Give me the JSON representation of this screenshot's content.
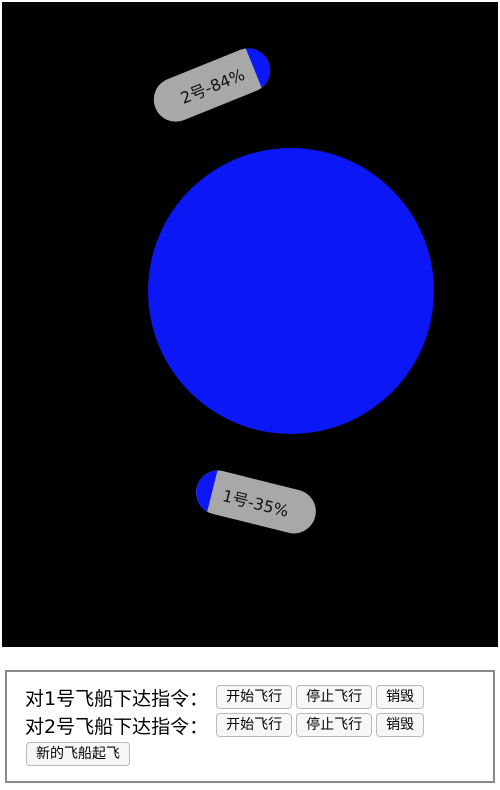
{
  "universe": {
    "background": "#000000",
    "planet_color": "#0b17f5"
  },
  "ships": [
    {
      "id": 1,
      "label": "1号-35%",
      "fuel_percent": 35,
      "color": "#a8a8a8"
    },
    {
      "id": 2,
      "label": "2号-84%",
      "fuel_percent": 84,
      "color": "#a8a8a8"
    }
  ],
  "controls": {
    "ship1": {
      "prompt": "对1号飞船下达指令：",
      "start": "开始飞行",
      "stop": "停止飞行",
      "destroy": "销毁"
    },
    "ship2": {
      "prompt": "对2号飞船下达指令：",
      "start": "开始飞行",
      "stop": "停止飞行",
      "destroy": "销毁"
    },
    "launch": "新的飞船起飞"
  }
}
